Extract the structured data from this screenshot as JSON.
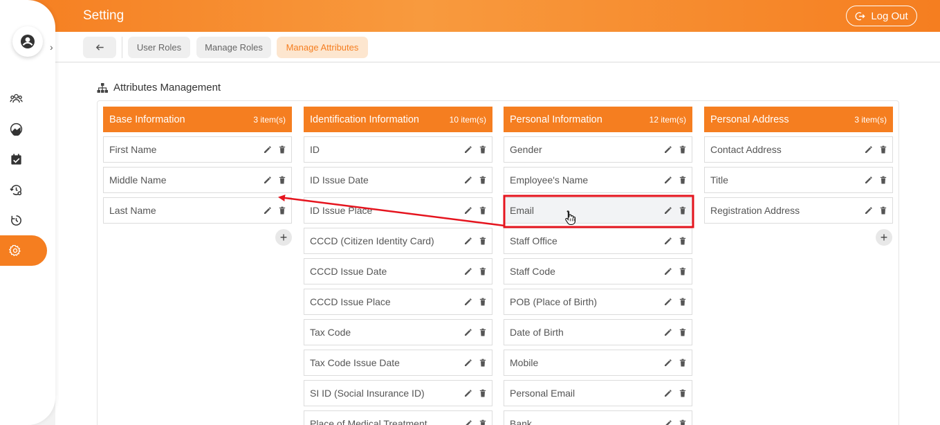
{
  "header": {
    "title": "Setting",
    "logout_label": "Log Out"
  },
  "tabs": [
    {
      "label": "User Roles",
      "active": false
    },
    {
      "label": "Manage Roles",
      "active": false
    },
    {
      "label": "Manage Attributes",
      "active": true
    }
  ],
  "section_title": "Attributes Management",
  "columns": [
    {
      "name": "Base Information",
      "count": "3 item(s)",
      "items": [
        "First Name",
        "Middle Name",
        "Last Name"
      ]
    },
    {
      "name": "Identification Information",
      "count": "10 item(s)",
      "items": [
        "ID",
        "ID Issue Date",
        "ID Issue Place",
        "CCCD (Citizen Identity Card)",
        "CCCD Issue Date",
        "CCCD Issue Place",
        "Tax Code",
        "Tax Code Issue Date",
        "SI ID (Social Insurance ID)",
        "Place of Medical Treatment"
      ]
    },
    {
      "name": "Personal Information",
      "count": "12 item(s)",
      "items": [
        "Gender",
        "Employee's Name",
        "Email",
        "Staff Office",
        "Staff Code",
        "POB (Place of Birth)",
        "Date of Birth",
        "Mobile",
        "Personal Email",
        "Bank"
      ]
    },
    {
      "name": "Personal Address",
      "count": "3 item(s)",
      "items": [
        "Contact Address",
        "Title",
        "Registration Address"
      ]
    }
  ],
  "icons": {
    "avatar": "user-circle-icon",
    "expand": "chevron-right-icon",
    "nav": [
      "users-icon",
      "dashboard-icon",
      "calendar-check-icon",
      "history-settings-icon",
      "clock-history-icon",
      "settings-icon"
    ],
    "item_actions": [
      "edit-icon",
      "trash-icon"
    ]
  },
  "colors": {
    "accent": "#f57e20",
    "accent_light": "#fde6cf",
    "annotation": "#e5141e"
  }
}
